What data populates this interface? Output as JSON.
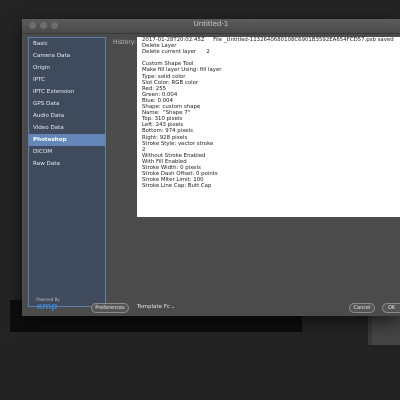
{
  "window": {
    "title": "Untitled-1"
  },
  "sidebar": {
    "items": [
      {
        "label": "Basic",
        "active": false
      },
      {
        "label": "Camera Data",
        "active": false
      },
      {
        "label": "Origin",
        "active": false
      },
      {
        "label": "IPTC",
        "active": false
      },
      {
        "label": "IPTC Extension",
        "active": false
      },
      {
        "label": "GPS Data",
        "active": false
      },
      {
        "label": "Audio Data",
        "active": false
      },
      {
        "label": "Video Data",
        "active": false
      },
      {
        "label": "Photoshop",
        "active": true
      },
      {
        "label": "DICOM",
        "active": false
      },
      {
        "label": "Raw Data",
        "active": false
      }
    ]
  },
  "branding": {
    "powered_by": "Powered By",
    "logo_text": "xmp"
  },
  "history": {
    "label": "History:",
    "lines": [
      "2017-01-28T20:02:45Z     File _Untitled-1132640680108C6901B3592EA654FCD57.psb saved",
      "Delete Layer",
      "Delete current layer      2",
      "",
      "Custom Shape Tool",
      "Make fill layer Using: fill layer",
      "Type: solid color",
      "Slot Color: RGB color",
      "Red: 255",
      "Green: 0.004",
      "Blue: 0.004",
      "Shape: custom shape",
      "Name:  \"Shape 7\"",
      "Top: 310 pixels",
      "Left: 243 pixels",
      "Bottom: 974 pixels",
      "Right: 928 pixels",
      "Stroke Style: vector stroke",
      "2",
      "Without Stroke Enabled",
      "With Fill Enabled",
      "Stroke Width: 0 pixels",
      "Stroke Dash Offset: 0 points",
      "Stroke Miter Limit: 100",
      "Stroke Line Cap: Butt Cap"
    ]
  },
  "footer": {
    "preferences_label": "Preferences",
    "template_label": "Template Fc",
    "cancel_label": "Cancel",
    "ok_label": "OK"
  }
}
